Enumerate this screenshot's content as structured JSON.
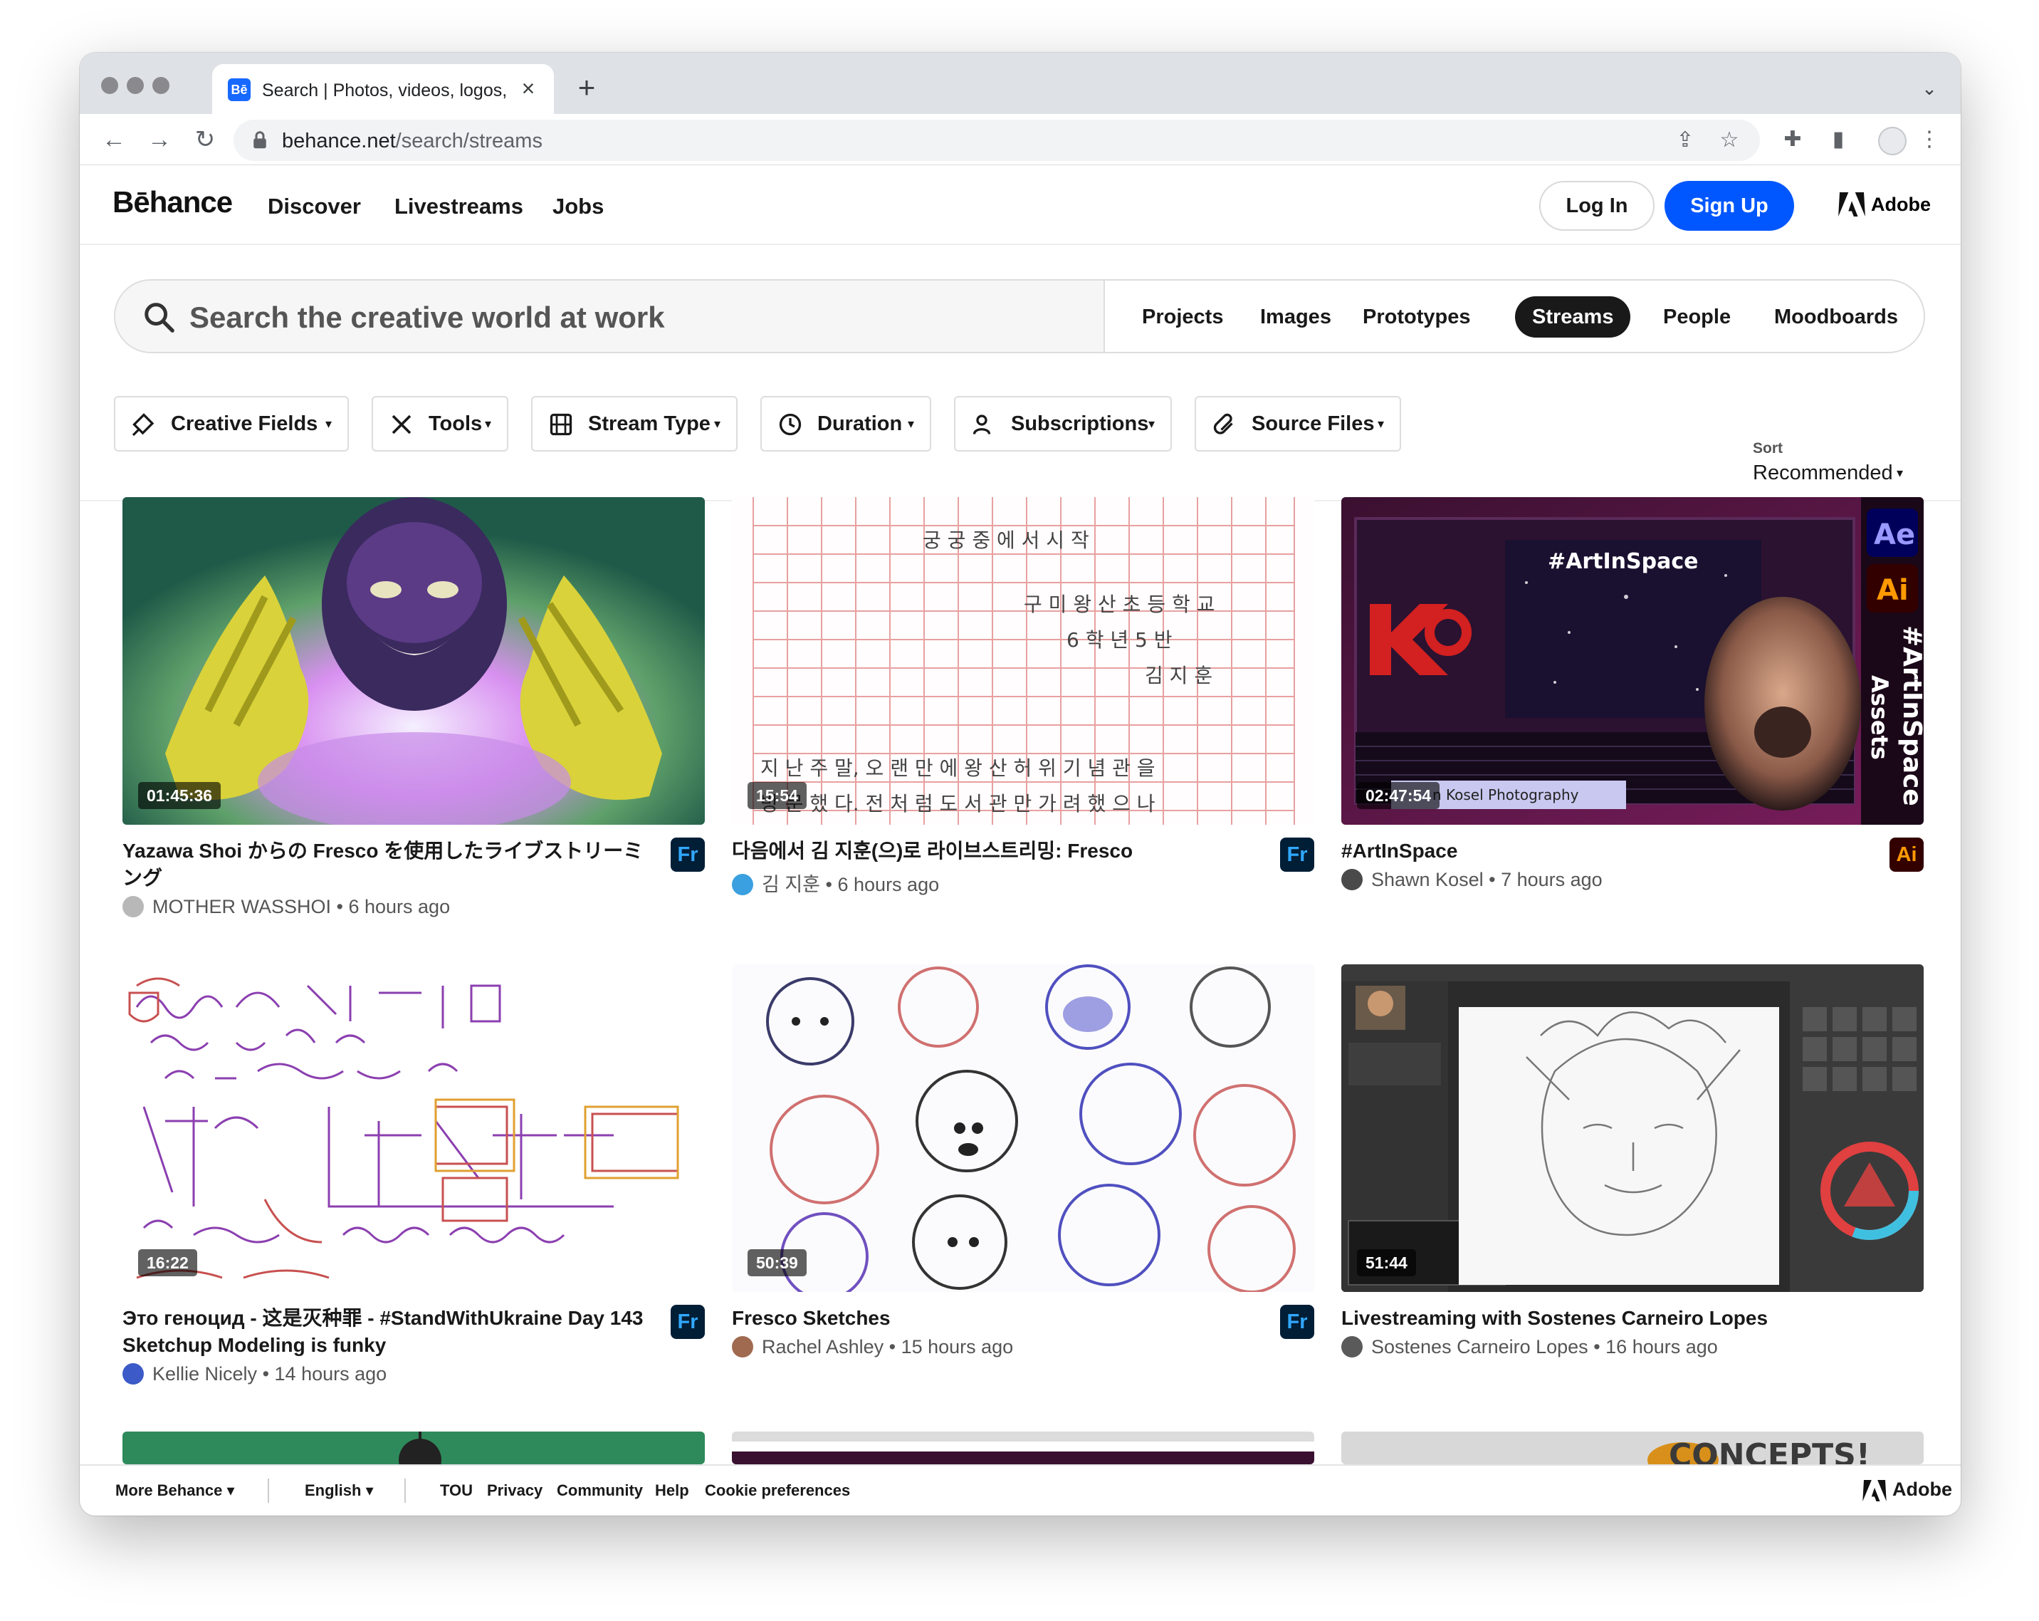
{
  "browser": {
    "tab_title": "Search | Photos, videos, logos, illustrations",
    "favicon_text": "Bē",
    "url_host": "behance.net",
    "url_path": "/search/streams"
  },
  "header": {
    "logo": "Bēhance",
    "nav": [
      "Discover",
      "Livestreams",
      "Jobs"
    ],
    "login": "Log In",
    "signup": "Sign Up",
    "adobe": "Adobe"
  },
  "search": {
    "placeholder": "Search the creative world at work",
    "tabs": [
      "Projects",
      "Images",
      "Prototypes",
      "Streams",
      "People",
      "Moodboards"
    ],
    "active_tab": "Streams"
  },
  "filters": {
    "items": [
      "Creative Fields",
      "Tools",
      "Stream Type",
      "Duration",
      "Subscriptions",
      "Source Files"
    ],
    "sort_label": "Sort",
    "sort_value": "Recommended"
  },
  "cards": [
    {
      "duration": "01:45:36",
      "title": "Yazawa Shoi からの Fresco を使用したライブストリーミング",
      "app": "Fr",
      "owner": "MOTHER WASSHOI",
      "time": "6 hours ago"
    },
    {
      "duration": "15:54",
      "title": "다음에서 김 지훈(으)로 라이브스트리밍: Fresco",
      "app": "Fr",
      "owner": "김 지훈",
      "time": "6 hours ago"
    },
    {
      "duration": "02:47:54",
      "title": "#ArtInSpace",
      "app": "Ai",
      "owner": "Shawn Kosel",
      "time": "7 hours ago"
    },
    {
      "duration": "16:22",
      "title": "Это геноцид - 这是灭种罪 - #StandWithUkraine Day 143 Sketchup Modeling is funky",
      "app": "Fr",
      "owner": "Kellie Nicely",
      "time": "14 hours ago"
    },
    {
      "duration": "50:39",
      "title": "Fresco Sketches",
      "app": "Fr",
      "owner": "Rachel Ashley",
      "time": "15 hours ago"
    },
    {
      "duration": "51:44",
      "title": "Livestreaming with Sostenes Carneiro Lopes",
      "app": "",
      "owner": "Sostenes Carneiro Lopes",
      "time": "16 hours ago"
    }
  ],
  "thumb_text": {
    "artinspace_hashtag": "#ArtInSpace",
    "ae": "Ae",
    "ai": "Ai",
    "side_banner_1": "#ArtInSpace",
    "side_banner_2": "Assets",
    "kosel_caption": "n Kosel Photography",
    "concepts": "CONCEPTS!"
  },
  "footer": {
    "more": "More Behance",
    "lang": "English",
    "links": [
      "TOU",
      "Privacy",
      "Community",
      "Help",
      "Cookie preferences"
    ],
    "adobe": "Adobe"
  },
  "colors": {
    "accent_blue": "#0057ff",
    "fresco_bg": "#001e36",
    "fresco_fg": "#31a8ff",
    "illustrator_bg": "#330000",
    "illustrator_fg": "#ff9a00"
  }
}
